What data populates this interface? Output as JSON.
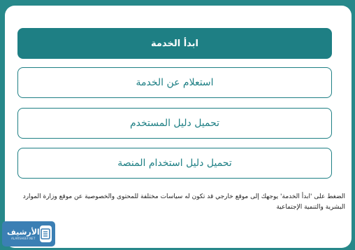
{
  "actions": {
    "start_service": "ابدأ الخدمة",
    "inquire_service": "استعلام عن الخدمة",
    "download_user_guide": "تحميل دليل المستخدم",
    "download_platform_guide": "تحميل دليل استخدام المنصة"
  },
  "disclaimer": "الضغط على 'ابدأ الخدمة' يوجهك إلى موقع خارجي قد تكون له سياسات مختلفة للمحتوى والخصوصية عن موقع وزارة الموارد البشرية والتنمية الإجتماعية",
  "watermark": {
    "title": "الأرشيف",
    "subtitle": "ALARSHEEF.NET",
    "icon": "document-icon"
  },
  "colors": {
    "primary": "#1e7f84",
    "background": "#27888a",
    "watermark": "#3b7fb4"
  }
}
